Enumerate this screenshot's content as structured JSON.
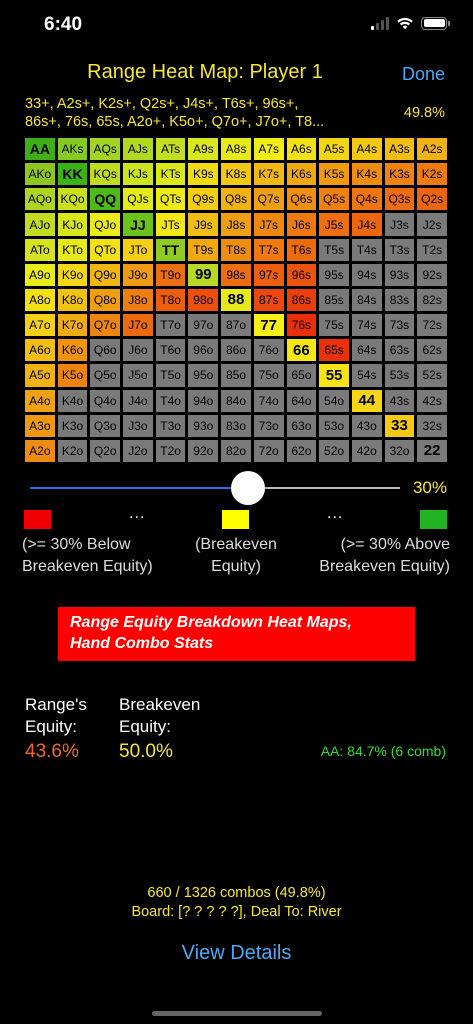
{
  "status": {
    "time": "6:40"
  },
  "header": {
    "title": "Range Heat Map: Player 1",
    "done_label": "Done",
    "range_text": "33+, A2s+, K2s+, Q2s+, J4s+, T6s+, 96s+,\n86s+, 76s, 65s, A2o+, K5o+, Q7o+, J7o+, T8...",
    "range_pct": "49.8%"
  },
  "grid": {
    "rows": [
      [
        "AA",
        "AKs",
        "AQs",
        "AJs",
        "ATs",
        "A9s",
        "A8s",
        "A7s",
        "A6s",
        "A5s",
        "A4s",
        "A3s",
        "A2s"
      ],
      [
        "AKo",
        "KK",
        "KQs",
        "KJs",
        "KTs",
        "K9s",
        "K8s",
        "K7s",
        "K6s",
        "K5s",
        "K4s",
        "K3s",
        "K2s"
      ],
      [
        "AQo",
        "KQo",
        "QQ",
        "QJs",
        "QTs",
        "Q9s",
        "Q8s",
        "Q7s",
        "Q6s",
        "Q5s",
        "Q4s",
        "Q3s",
        "Q2s"
      ],
      [
        "AJo",
        "KJo",
        "QJo",
        "JJ",
        "JTs",
        "J9s",
        "J8s",
        "J7s",
        "J6s",
        "J5s",
        "J4s",
        "J3s",
        "J2s"
      ],
      [
        "ATo",
        "KTo",
        "QTo",
        "JTo",
        "TT",
        "T9s",
        "T8s",
        "T7s",
        "T6s",
        "T5s",
        "T4s",
        "T3s",
        "T2s"
      ],
      [
        "A9o",
        "K9o",
        "Q9o",
        "J9o",
        "T9o",
        "99",
        "98s",
        "97s",
        "96s",
        "95s",
        "94s",
        "93s",
        "92s"
      ],
      [
        "A8o",
        "K8o",
        "Q8o",
        "J8o",
        "T8o",
        "98o",
        "88",
        "87s",
        "86s",
        "85s",
        "84s",
        "83s",
        "82s"
      ],
      [
        "A7o",
        "K7o",
        "Q7o",
        "J7o",
        "T7o",
        "97o",
        "87o",
        "77",
        "76s",
        "75s",
        "74s",
        "73s",
        "72s"
      ],
      [
        "A6o",
        "K6o",
        "Q6o",
        "J6o",
        "T6o",
        "96o",
        "86o",
        "76o",
        "66",
        "65s",
        "64s",
        "63s",
        "62s"
      ],
      [
        "A5o",
        "K5o",
        "Q5o",
        "J5o",
        "T5o",
        "95o",
        "85o",
        "75o",
        "65o",
        "55",
        "54s",
        "53s",
        "52s"
      ],
      [
        "A4o",
        "K4o",
        "Q4o",
        "J4o",
        "T4o",
        "94o",
        "84o",
        "74o",
        "64o",
        "54o",
        "44",
        "43s",
        "42s"
      ],
      [
        "A3o",
        "K3o",
        "Q3o",
        "J3o",
        "T3o",
        "93o",
        "83o",
        "73o",
        "63o",
        "53o",
        "43o",
        "33",
        "32s"
      ],
      [
        "A2o",
        "K2o",
        "Q2o",
        "J2o",
        "T2o",
        "92o",
        "82o",
        "72o",
        "62o",
        "52o",
        "42o",
        "32o",
        "22"
      ]
    ],
    "colors": [
      [
        "#3fae18",
        "#83cb21",
        "#a3d422",
        "#b2d922",
        "#c4de21",
        "#d9e81c",
        "#e6ea1a",
        "#f0ed18",
        "#f3e117",
        "#f2d616",
        "#f3c914",
        "#f3be14",
        "#f0b214"
      ],
      [
        "#8ec521",
        "#39b318",
        "#c0dc20",
        "#cde31e",
        "#dae81c",
        "#f2db16",
        "#f1c814",
        "#f1b713",
        "#f0a812",
        "#f09a11",
        "#ef8d10",
        "#ef8210",
        "#ee7a10"
      ],
      [
        "#aed522",
        "#c9e01f",
        "#4eba1a",
        "#e2ea1b",
        "#eeea18",
        "#f2cc15",
        "#f0b313",
        "#efa012",
        "#ef8f11",
        "#ee8010",
        "#ee7510",
        "#ed6c10",
        "#ed660f"
      ],
      [
        "#c3dc21",
        "#d9e61c",
        "#ecea19",
        "#6cc21d",
        "#f2e616",
        "#f0bd14",
        "#efa012",
        "#ee8910",
        "#ed7a10",
        "#ed6f10",
        "#ec660f",
        "#7a7a7a",
        "#7a7a7a"
      ],
      [
        "#d4e31e",
        "#e6e91a",
        "#f2e117",
        "#f3cf15",
        "#8fcb22",
        "#f0a913",
        "#ee8e11",
        "#ed7910",
        "#ec6b0f",
        "#7a7a7a",
        "#7a7a7a",
        "#7a7a7a",
        "#7a7a7a"
      ],
      [
        "#e8ea1a",
        "#f3d716",
        "#f0b713",
        "#ef9b11",
        "#ec6f10",
        "#b8d923",
        "#ec6e10",
        "#ec5f0f",
        "#eb540e",
        "#7a7a7a",
        "#7a7a7a",
        "#7a7a7a",
        "#7a7a7a"
      ],
      [
        "#f2e016",
        "#f0c214",
        "#ef9d11",
        "#ed7e10",
        "#ec5f0f",
        "#eb500e",
        "#e6ea1a",
        "#ea480e",
        "#ea3f0d",
        "#7a7a7a",
        "#7a7a7a",
        "#7a7a7a",
        "#7a7a7a"
      ],
      [
        "#f3cf15",
        "#f0ab12",
        "#ed8510",
        "#ec6a0f",
        "#7a7a7a",
        "#7a7a7a",
        "#7a7a7a",
        "#f7f016",
        "#ea2e0c",
        "#7a7a7a",
        "#7a7a7a",
        "#7a7a7a",
        "#7a7a7a"
      ],
      [
        "#f1be14",
        "#ee9411",
        "#7a7a7a",
        "#7a7a7a",
        "#7a7a7a",
        "#7a7a7a",
        "#7a7a7a",
        "#7a7a7a",
        "#f5e717",
        "#e9320c",
        "#7a7a7a",
        "#7a7a7a",
        "#7a7a7a"
      ],
      [
        "#f0b113",
        "#ed8410",
        "#7a7a7a",
        "#7a7a7a",
        "#7a7a7a",
        "#7a7a7a",
        "#7a7a7a",
        "#7a7a7a",
        "#7a7a7a",
        "#f6e417",
        "#7a7a7a",
        "#7a7a7a",
        "#7a7a7a"
      ],
      [
        "#efa312",
        "#7a7a7a",
        "#7a7a7a",
        "#7a7a7a",
        "#7a7a7a",
        "#7a7a7a",
        "#7a7a7a",
        "#7a7a7a",
        "#7a7a7a",
        "#7a7a7a",
        "#f4d616",
        "#7a7a7a",
        "#7a7a7a"
      ],
      [
        "#ee9711",
        "#7a7a7a",
        "#7a7a7a",
        "#7a7a7a",
        "#7a7a7a",
        "#7a7a7a",
        "#7a7a7a",
        "#7a7a7a",
        "#7a7a7a",
        "#7a7a7a",
        "#7a7a7a",
        "#f3c914",
        "#7a7a7a"
      ],
      [
        "#ee8b10",
        "#7a7a7a",
        "#7a7a7a",
        "#7a7a7a",
        "#7a7a7a",
        "#7a7a7a",
        "#7a7a7a",
        "#7a7a7a",
        "#7a7a7a",
        "#7a7a7a",
        "#7a7a7a",
        "#7a7a7a",
        "#7a7a7a"
      ]
    ]
  },
  "slider": {
    "value_label": "30%",
    "fraction": 0.59
  },
  "legend": {
    "colors": {
      "low": "#f00000",
      "mid": "#ffff00",
      "high": "#22b422"
    },
    "dots": "...",
    "low_label": "(>= 30% Below\nBreakeven Equity)",
    "mid_label": "(Breakeven\nEquity)",
    "high_label": "(>= 30% Above\nBreakeven Equity)"
  },
  "banner": {
    "label": "Range Equity Breakdown Heat Maps,\nHand Combo Stats"
  },
  "stats": {
    "range_equity_label": "Range's\nEquity:",
    "range_equity_value": "43.6%",
    "range_equity_color": "#f06a1c",
    "breakeven_label": "Breakeven\nEquity:",
    "breakeven_value": "50.0%",
    "breakeven_color": "#f7e733",
    "aa_stat": "AA: 84.7% (6 comb)"
  },
  "footer": {
    "combos": "660 / 1326 combos (49.8%)",
    "board": "Board: [? ? ? ? ?], Deal To: River",
    "view_details": "View Details"
  }
}
